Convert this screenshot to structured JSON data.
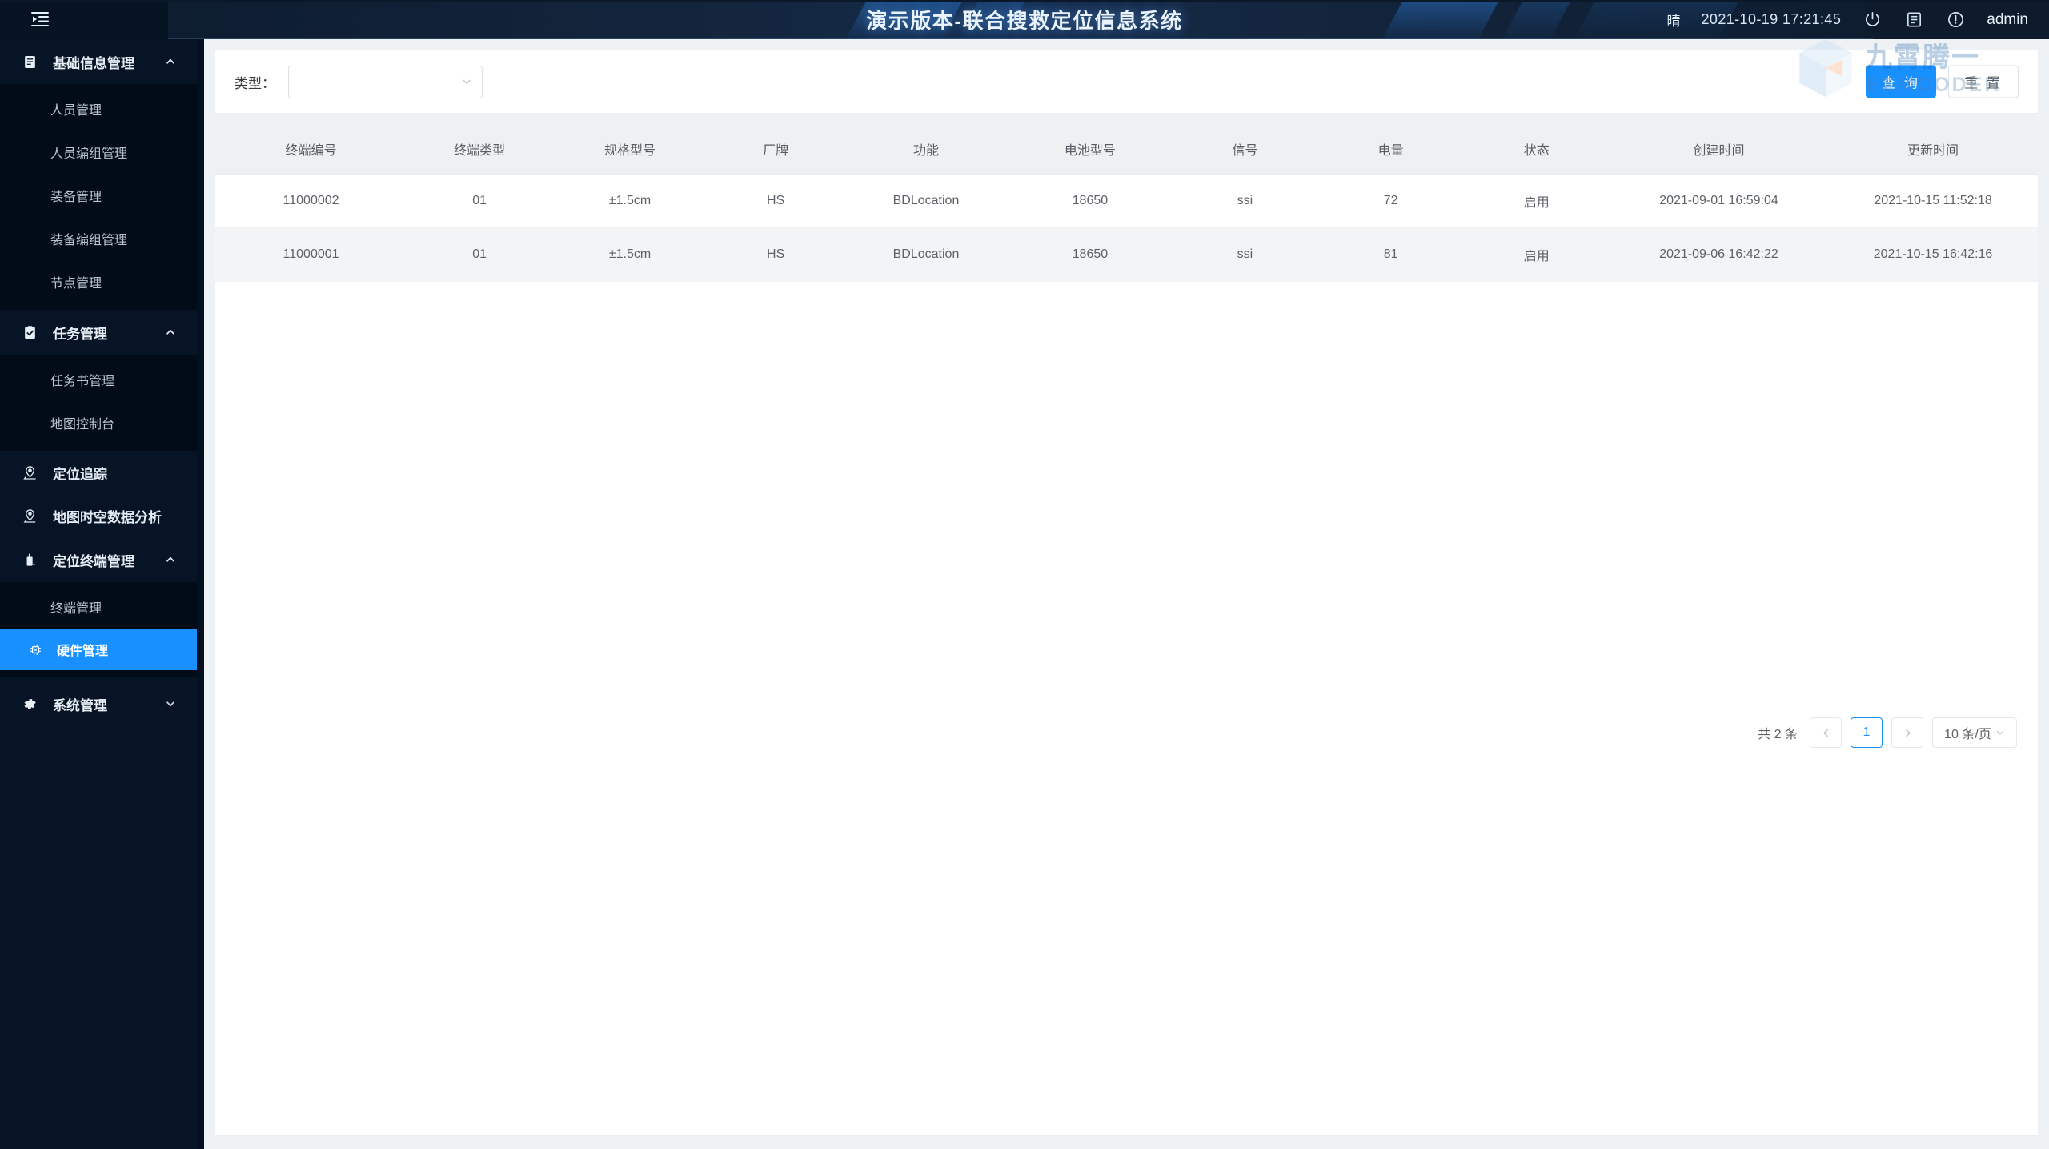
{
  "header": {
    "title": "演示版本-联合搜救定位信息系统",
    "menu_toggle_icon": "menu-fold-icon",
    "weather": "晴",
    "datetime": "2021-10-19 17:21:45",
    "icons": [
      "power-icon",
      "screen-icon",
      "info-circle-icon"
    ],
    "user": "admin"
  },
  "sidebar": {
    "groups": [
      {
        "label": "基础信息管理",
        "icon": "document-icon",
        "expanded": true,
        "chevron": "chevron-up-icon",
        "items": [
          {
            "label": "人员管理",
            "active": false
          },
          {
            "label": "人员编组管理",
            "active": false
          },
          {
            "label": "装备管理",
            "active": false
          },
          {
            "label": "装备编组管理",
            "active": false
          },
          {
            "label": "节点管理",
            "active": false
          }
        ]
      },
      {
        "label": "任务管理",
        "icon": "clipboard-check-icon",
        "expanded": true,
        "chevron": "chevron-up-icon",
        "items": [
          {
            "label": "任务书管理",
            "active": false
          },
          {
            "label": "地图控制台",
            "active": false
          }
        ]
      }
    ],
    "leaves": [
      {
        "label": "定位追踪",
        "icon": "location-pin-icon"
      },
      {
        "label": "地图时空数据分析",
        "icon": "location-pin-icon"
      }
    ],
    "terminal_group": {
      "label": "定位终端管理",
      "icon": "radio-device-icon",
      "expanded": true,
      "chevron": "chevron-up-icon",
      "items": [
        {
          "label": "终端管理",
          "active": false
        },
        {
          "label": "硬件管理",
          "active": true,
          "icon": "chip-icon"
        }
      ]
    },
    "system_group": {
      "label": "系统管理",
      "icon": "gear-icon",
      "expanded": false,
      "chevron": "chevron-down-icon"
    }
  },
  "filter": {
    "type_label": "类型：",
    "type_value": "",
    "type_placeholder": "",
    "dropdown_icon": "chevron-down-icon",
    "query_label": "查 询",
    "reset_label": "重 置"
  },
  "table": {
    "columns": [
      "终端编号",
      "终端类型",
      "规格型号",
      "厂牌",
      "功能",
      "电池型号",
      "信号",
      "电量",
      "状态",
      "创建时间",
      "更新时间"
    ],
    "rows": [
      {
        "terminal_no": "11000002",
        "terminal_type": "01",
        "spec_model": "±1.5cm",
        "brand": "HS",
        "function": "BDLocation",
        "battery_model": "18650",
        "signal": "ssi",
        "power": "72",
        "status": "启用",
        "created_at": "2021-09-01 16:59:04",
        "updated_at": "2021-10-15 11:52:18"
      },
      {
        "terminal_no": "11000001",
        "terminal_type": "01",
        "spec_model": "±1.5cm",
        "brand": "HS",
        "function": "BDLocation",
        "battery_model": "18650",
        "signal": "ssi",
        "power": "81",
        "status": "启用",
        "created_at": "2021-09-06 16:42:22",
        "updated_at": "2021-10-15 16:42:16"
      }
    ]
  },
  "pagination": {
    "total_text": "共 2 条",
    "prev_icon": "chevron-left-icon",
    "current_page": "1",
    "next_icon": "chevron-right-icon",
    "page_size": "10 条/页",
    "page_size_icon": "chevron-down-icon"
  },
  "watermark": {
    "text_cn": "九霄腾一",
    "text_en": "EEMCODER",
    "icon": "cube-logo-icon"
  },
  "colors": {
    "accent": "#1890ff",
    "header_bg": "#0d1b2d",
    "sidebar_bg": "#061425",
    "submenu_bg": "#020c18",
    "content_bg": "#eff2f5"
  }
}
